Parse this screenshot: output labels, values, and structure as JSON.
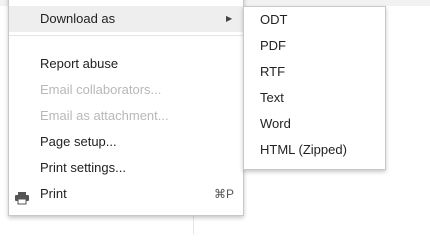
{
  "main_menu": {
    "download_as": "Download as",
    "report_abuse": "Report abuse",
    "email_collaborators": "Email collaborators...",
    "email_attachment": "Email as attachment...",
    "page_setup": "Page setup...",
    "print_settings": "Print settings...",
    "print": "Print",
    "print_shortcut": "⌘P"
  },
  "download_submenu": {
    "items": [
      "ODT",
      "PDF",
      "RTF",
      "Text",
      "Word",
      "HTML (Zipped)"
    ]
  },
  "icons": {
    "submenu_arrow": "arrow-right-icon",
    "print": "printer-icon"
  },
  "colors": {
    "highlight": "#eeeeee",
    "disabled_text": "#b8b8b8",
    "text": "#222222"
  }
}
